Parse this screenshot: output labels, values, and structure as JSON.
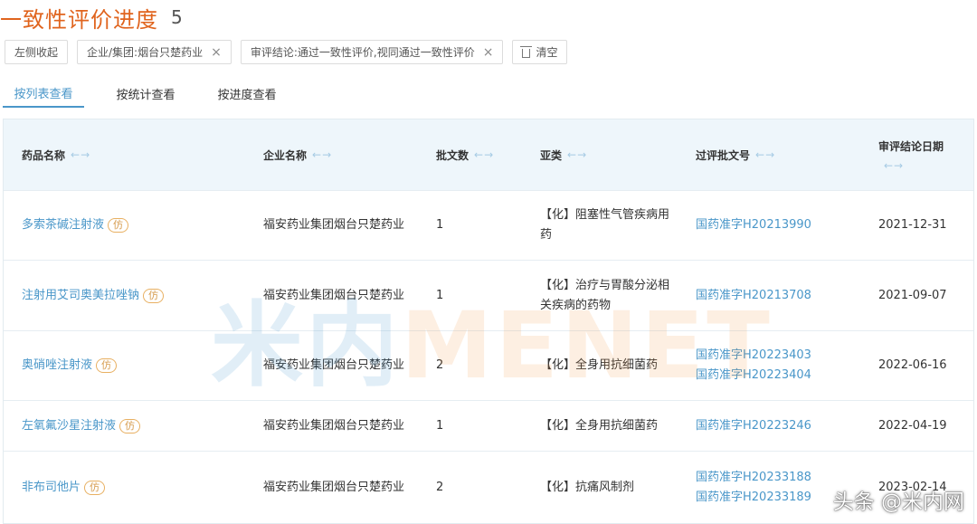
{
  "header": {
    "title": "一致性评价进度",
    "count": "5"
  },
  "filters": {
    "collapse_label": "左侧收起",
    "chips": [
      "企业/集团:烟台只楚药业",
      "审评结论:通过一致性评价,视同通过一致性评价"
    ],
    "clear_label": "清空"
  },
  "tabs": [
    "按列表查看",
    "按统计查看",
    "按进度查看"
  ],
  "table": {
    "columns": [
      "药品名称",
      "企业名称",
      "批文数",
      "亚类",
      "过评批文号",
      "审评结论日期"
    ],
    "sort_glyph": "←→",
    "imitation_badge": "仿",
    "rows": [
      {
        "drug": "多索茶碱注射液",
        "company": "福安药业集团烟台只楚药业",
        "count": "1",
        "subclass": "【化】阻塞性气管疾病用药",
        "approvals": [
          "国药准字H20213990"
        ],
        "date": "2021-12-31"
      },
      {
        "drug": "注射用艾司奥美拉唑钠",
        "company": "福安药业集团烟台只楚药业",
        "count": "1",
        "subclass": "【化】治疗与胃酸分泌相关疾病的药物",
        "approvals": [
          "国药准字H20213708"
        ],
        "date": "2021-09-07"
      },
      {
        "drug": "奥硝唑注射液",
        "company": "福安药业集团烟台只楚药业",
        "count": "2",
        "subclass": "【化】全身用抗细菌药",
        "approvals": [
          "国药准字H20223403",
          "国药准字H20223404"
        ],
        "date": "2022-06-16"
      },
      {
        "drug": "左氧氟沙星注射液",
        "company": "福安药业集团烟台只楚药业",
        "count": "1",
        "subclass": "【化】全身用抗细菌药",
        "approvals": [
          "国药准字H20223246"
        ],
        "date": "2022-04-19"
      },
      {
        "drug": "非布司他片",
        "company": "福安药业集团烟台只楚药业",
        "count": "2",
        "subclass": "【化】抗痛风制剂",
        "approvals": [
          "国药准字H20233188",
          "国药准字H20233189"
        ],
        "date": "2023-02-14"
      }
    ]
  },
  "watermark": {
    "cn": "米内",
    "en": "MENET"
  },
  "credit": "头条 @米内网"
}
